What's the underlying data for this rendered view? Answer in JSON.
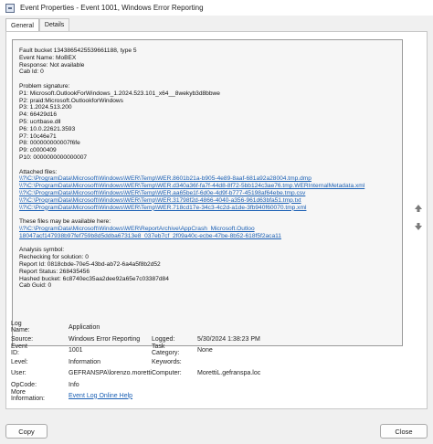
{
  "window": {
    "title": "Event Properties - Event 1001, Windows Error Reporting"
  },
  "tabs": [
    {
      "label": "General"
    },
    {
      "label": "Details"
    }
  ],
  "description": {
    "block1": [
      "Fault bucket 1343865425539661188, type 5",
      "Event Name: MoBEX",
      "Response: Not available",
      "Cab Id: 0"
    ],
    "block2": [
      "Problem signature:",
      "P1: Microsoft.OutlookForWindows_1.2024.523.101_x64__8wekyb3d8bbwe",
      "P2: praid:Microsoft.OutlookforWindows",
      "P3: 1.2024.513.200",
      "P4: 66429d16",
      "P5: ucrtbase.dll",
      "P6: 10.0.22621.3593",
      "P7: 10c46e71",
      "P8: 000000000007f6fe",
      "P9: c0000409",
      "P10: 0000000000000007"
    ],
    "attached_title": "Attached files:",
    "attached": [
      "\\\\?\\C:\\ProgramData\\Microsoft\\Windows\\WER\\Temp\\WER.8601b21a-b905-4e89-8aaf-681a92a28004.tmp.dmp",
      "\\\\?\\C:\\ProgramData\\Microsoft\\Windows\\WER\\Temp\\WER.d340a36f-fa7f-44d8-8f72-5bb124c3ae76.tmp.WERInternalMetadata.xml",
      "\\\\?\\C:\\ProgramData\\Microsoft\\Windows\\WER\\Temp\\WER.aa65be1f-6d0e-4d9f-b777-45198af64ebe.tmp.csv",
      "\\\\?\\C:\\ProgramData\\Microsoft\\Windows\\WER\\Temp\\WER.31798f2d-4866-4040-a356-961d63bfa51.tmp.txt",
      "\\\\?\\C:\\ProgramData\\Microsoft\\Windows\\WER\\Temp\\WER.718cd17e-34c3-4c2d-a1de-3fb940f60070.tmp.xml"
    ],
    "available_title": "These files may be available here:",
    "available": [
      "\\\\?\\C:\\ProgramData\\Microsoft\\Windows\\WER\\ReportArchive\\AppCrash_Microsoft.Outloo",
      "18047acf147938b97fef759b8d5ddba67313e8_037eb7cf_2f09a40c-ecbe-47be-8b52-618f5f2aca11"
    ],
    "block3": [
      "Analysis symbol:",
      "Rechecking for solution: 0",
      "Report Id: 0818cbde-70e5-43bd-ab72-6a4a5f8b2d52",
      "Report Status: 268435456",
      "Hashed bucket: 6c8740ec35aa2dee92a65e7c03387d84",
      "Cab Guid: 0"
    ]
  },
  "fields": {
    "log_name": {
      "label": "Log Name:",
      "value": "Application"
    },
    "source": {
      "label": "Source:",
      "value": "Windows Error Reporting"
    },
    "logged": {
      "label": "Logged:",
      "value": "5/30/2024 1:38:23 PM"
    },
    "event_id": {
      "label": "Event ID:",
      "value": "1001"
    },
    "task_category": {
      "label": "Task Category:",
      "value": "None"
    },
    "level": {
      "label": "Level:",
      "value": "Information"
    },
    "keywords": {
      "label": "Keywords:",
      "value": ""
    },
    "user": {
      "label": "User:",
      "value": "GEFRANSPA\\lorenzo.moretti"
    },
    "computer": {
      "label": "Computer:",
      "value": "MorettiL.gefranspa.loc"
    },
    "opcode": {
      "label": "OpCode:",
      "value": "Info"
    },
    "more_info": {
      "label": "More Information:",
      "value": "Event Log Online Help"
    }
  },
  "buttons": {
    "copy": "Copy",
    "close": "Close"
  },
  "icons": {
    "copy_icon": "copy-icon",
    "scroll_up": "arrow-up-icon",
    "scroll_down": "arrow-down-icon"
  }
}
